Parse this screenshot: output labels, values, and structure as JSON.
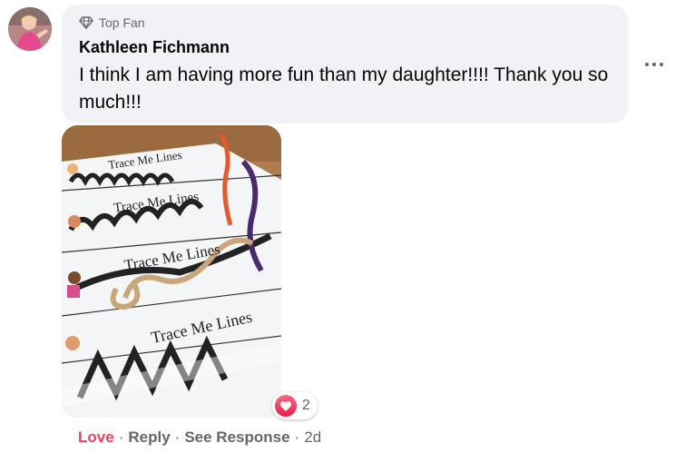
{
  "comment": {
    "badge_label": "Top Fan",
    "author": "Kathleen Fichmann",
    "text": "I think I am having more fun than my daughter!!!! Thank you so much!!!"
  },
  "photo": {
    "worksheet_title": "Trace Me Lines"
  },
  "reaction": {
    "type": "love",
    "count": "2",
    "color": "#f33e58"
  },
  "actions": {
    "love_label": "Love",
    "reply_label": "Reply",
    "see_response_label": "See Response",
    "separator": "·",
    "timestamp": "2d"
  },
  "icons": {
    "badge": "diamond-icon",
    "more": "more-options-icon",
    "reaction": "heart-icon"
  }
}
